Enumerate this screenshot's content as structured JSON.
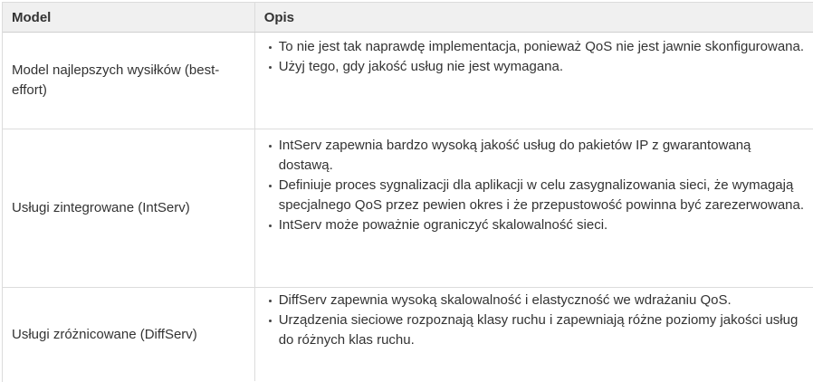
{
  "table": {
    "headers": [
      "Model",
      "Opis"
    ],
    "rows": [
      {
        "model": "Model najlepszych wysiłków (best-effort)",
        "items": [
          "To nie jest tak naprawdę implementacja, ponieważ QoS nie jest jawnie skonfigurowana.",
          "Użyj tego, gdy jakość usług nie jest wymagana."
        ]
      },
      {
        "model": "Usługi zintegrowane (IntServ)",
        "items": [
          "IntServ zapewnia bardzo wysoką jakość usług do pakietów IP z gwarantowaną dostawą.",
          "Definiuje proces sygnalizacji dla aplikacji w celu zasygnalizowania sieci, że wymagają specjalnego QoS przez pewien okres i że przepustowość powinna być zarezerwowana.",
          "IntServ może poważnie ograniczyć skalowalność sieci."
        ]
      },
      {
        "model": "Usługi zróżnicowane (DiffServ)",
        "items": [
          "DiffServ zapewnia wysoką skalowalność i elastyczność we wdrażaniu QoS.",
          "Urządzenia sieciowe rozpoznają klasy ruchu i zapewniają różne poziomy jakości usług do różnych klas ruchu."
        ]
      }
    ]
  }
}
